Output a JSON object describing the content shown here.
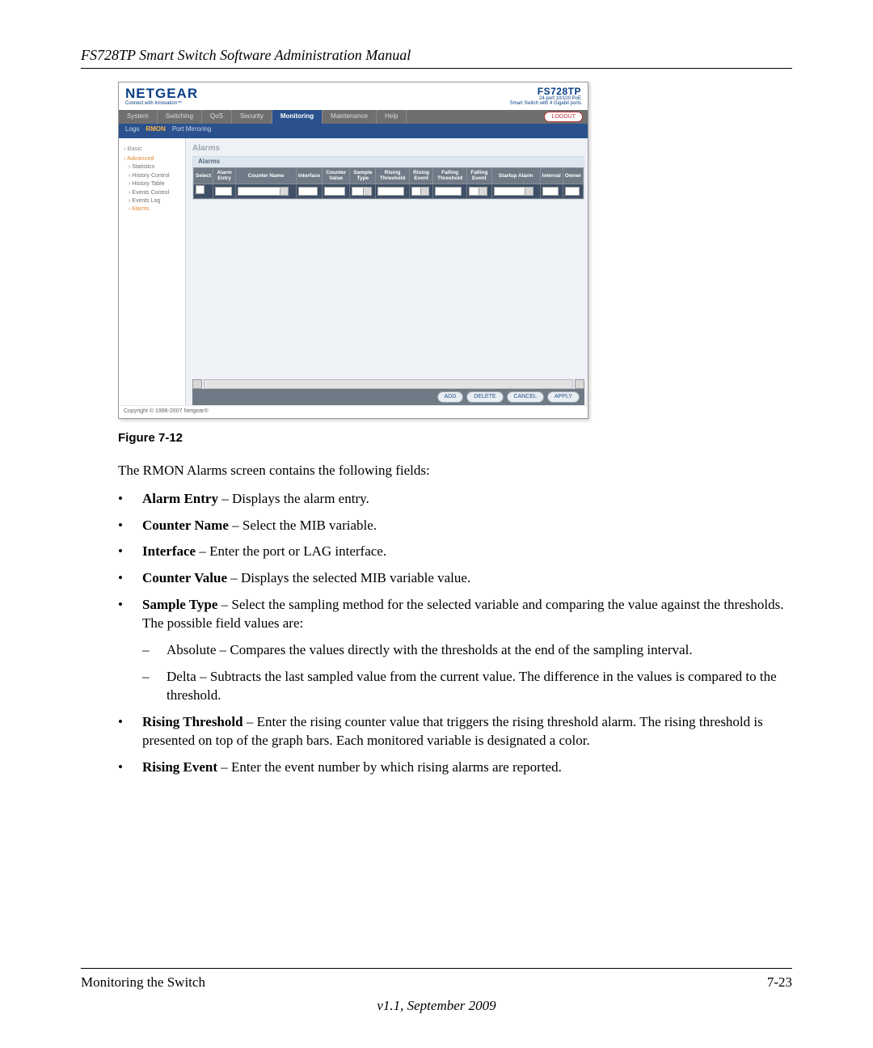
{
  "doc": {
    "running_head": "FS728TP Smart Switch Software Administration Manual",
    "figure_caption": "Figure 7-12",
    "intro": "The RMON Alarms screen contains the following fields:",
    "footer_left": "Monitoring the Switch",
    "footer_right": "7-23",
    "footer_version": "v1.1, September 2009"
  },
  "screenshot": {
    "brand": "NETGEAR",
    "brand_tagline": "Connect with Innovation™",
    "model": "FS728TP",
    "model_sub1": "24-port 10/100 PoE",
    "model_sub2": "Smart Switch with 4 Gigabit ports",
    "logout": "LOGOUT",
    "tabs": [
      "System",
      "Switching",
      "QoS",
      "Security",
      "Monitoring",
      "Maintenance",
      "Help"
    ],
    "active_tab": "Monitoring",
    "subtabs": [
      "Logs",
      "RMON",
      "Port Mirroring"
    ],
    "active_subtab": "RMON",
    "sidebar": {
      "groups": [
        {
          "label": "Basic",
          "selected": false
        },
        {
          "label": "Advanced",
          "selected": true
        }
      ],
      "items": [
        {
          "label": "Statistics",
          "selected": false
        },
        {
          "label": "History Control",
          "selected": false
        },
        {
          "label": "History Table",
          "selected": false
        },
        {
          "label": "Events Control",
          "selected": false
        },
        {
          "label": "Events Log",
          "selected": false
        },
        {
          "label": "Alarms",
          "selected": true
        }
      ]
    },
    "content_title": "Alarms",
    "panel_title": "Alarms",
    "columns": [
      "Select",
      "Alarm Entry",
      "Counter Name",
      "Interface",
      "Counter Value",
      "Sample Type",
      "Rising Threshold",
      "Rising Event",
      "Falling Threshold",
      "Falling Event",
      "Startup Alarm",
      "Interval",
      "Owner"
    ],
    "actions": [
      "ADD",
      "DELETE",
      "CANCEL",
      "APPLY"
    ],
    "copyright": "Copyright © 1996-2007 Netgear®"
  },
  "bullets": [
    {
      "term": "Alarm Entry",
      "desc": " – Displays the alarm entry."
    },
    {
      "term": "Counter Name",
      "desc": " – Select the MIB variable."
    },
    {
      "term": "Interface",
      "desc": " – Enter the port or LAG interface."
    },
    {
      "term": "Counter Value",
      "desc": " – Displays the selected MIB variable value."
    },
    {
      "term": "Sample Type",
      "desc": " – Select the sampling method for the selected variable and comparing the value against the thresholds. The possible field values are:",
      "subs": [
        "Absolute – Compares the values directly with the thresholds at the end of the sampling interval.",
        "Delta – Subtracts the last sampled value from the current value. The difference in the values is compared to the threshold."
      ]
    },
    {
      "term": "Rising Threshold",
      "desc": " – Enter the rising counter value that triggers the rising threshold alarm. The rising threshold is presented on top of the graph bars. Each monitored variable is designated a color."
    },
    {
      "term": "Rising Event",
      "desc": " – Enter the event number by which rising alarms are reported."
    }
  ]
}
